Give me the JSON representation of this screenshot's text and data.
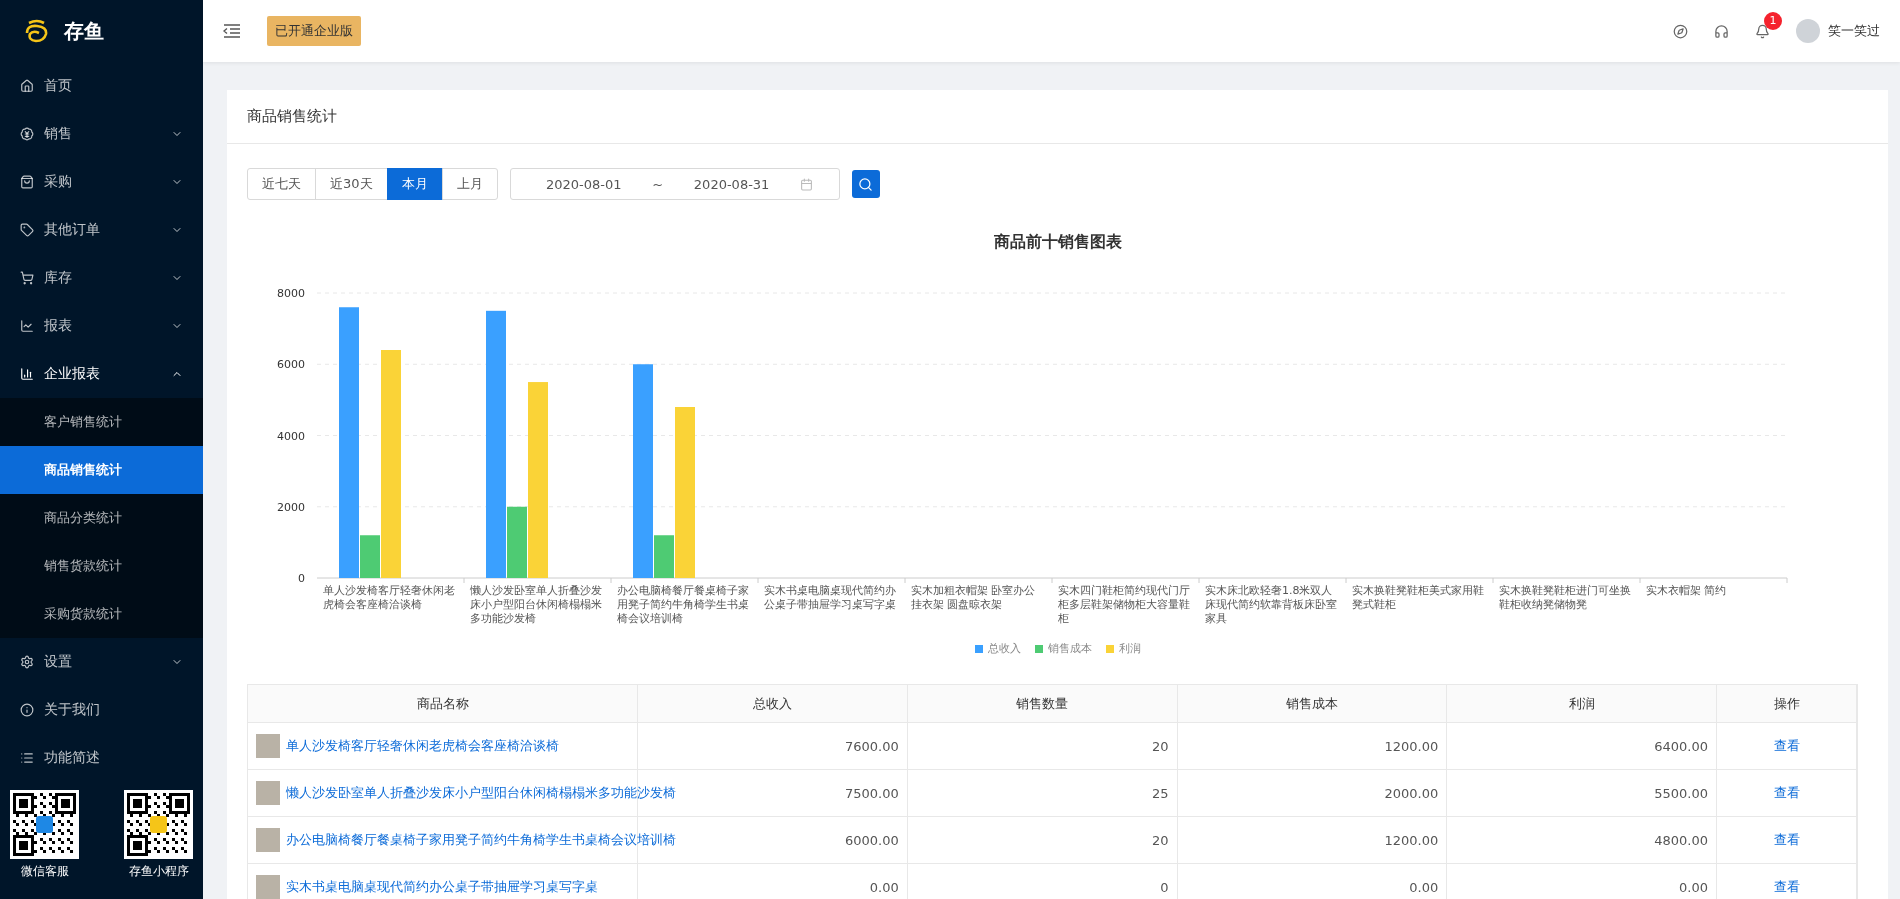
{
  "sidebar": {
    "logo": "存鱼",
    "items": [
      {
        "label": "首页",
        "kind": "link"
      },
      {
        "label": "销售",
        "kind": "group",
        "expanded": false
      },
      {
        "label": "采购",
        "kind": "group",
        "expanded": false
      },
      {
        "label": "其他订单",
        "kind": "group",
        "expanded": false
      },
      {
        "label": "库存",
        "kind": "group",
        "expanded": false
      },
      {
        "label": "报表",
        "kind": "group",
        "expanded": false
      },
      {
        "label": "企业报表",
        "kind": "group",
        "expanded": true,
        "children": [
          {
            "label": "客户销售统计",
            "selected": false
          },
          {
            "label": "商品销售统计",
            "selected": true
          },
          {
            "label": "商品分类统计",
            "selected": false
          },
          {
            "label": "销售货款统计",
            "selected": false
          },
          {
            "label": "采购货款统计",
            "selected": false
          }
        ]
      },
      {
        "label": "设置",
        "kind": "group",
        "expanded": false
      },
      {
        "label": "关于我们",
        "kind": "link"
      },
      {
        "label": "功能简述",
        "kind": "link"
      }
    ],
    "qr_codes": [
      {
        "caption": "微信客服"
      },
      {
        "caption": "存鱼小程序"
      }
    ]
  },
  "topbar": {
    "badge": "已开通企业版",
    "notification_count": "1",
    "user": "笑一笑过"
  },
  "page": {
    "title": "商品销售统计",
    "ranges": [
      {
        "label": "近七天",
        "selected": false
      },
      {
        "label": "近30天",
        "selected": false
      },
      {
        "label": "本月",
        "selected": true
      },
      {
        "label": "上月",
        "selected": false
      }
    ],
    "date_start": "2020-08-01",
    "date_separator": "~",
    "date_end": "2020-08-31"
  },
  "chart_data": {
    "type": "bar",
    "title": "商品前十销售图表",
    "categories": [
      "单人沙发椅客厅轻奢休闲老虎椅会客座椅洽谈椅",
      "懒人沙发卧室单人折叠沙发床小户型阳台休闲椅榻榻米多功能沙发椅",
      "办公电脑椅餐厅餐桌椅子家用凳子简约牛角椅学生书桌椅会议培训椅",
      "实木书桌电脑桌现代简约办公桌子带抽屉学习桌写字桌",
      "实木加粗衣帽架 卧室办公挂衣架 圆盘晾衣架",
      "实木四门鞋柜简约现代门厅柜多层鞋架储物柜大容量鞋柜",
      "实木床北欧轻奢1.8米双人床现代简约软靠背板床卧室家具",
      "实木换鞋凳鞋柜美式家用鞋凳式鞋柜",
      "实木换鞋凳鞋柜进门可坐换鞋柜收纳凳储物凳",
      "实木衣帽架 简约"
    ],
    "series": [
      {
        "name": "总收入",
        "color": "#3aa0ff",
        "values": [
          7600,
          7500,
          6000,
          0,
          0,
          0,
          0,
          0,
          0,
          0
        ]
      },
      {
        "name": "销售成本",
        "color": "#4ecb73",
        "values": [
          1200,
          2000,
          1200,
          0,
          0,
          0,
          0,
          0,
          0,
          0
        ]
      },
      {
        "name": "利润",
        "color": "#fad337",
        "values": [
          6400,
          5500,
          4800,
          0,
          0,
          0,
          0,
          0,
          0,
          0
        ]
      }
    ],
    "ylim": [
      0,
      8000
    ],
    "yticks": [
      0,
      2000,
      4000,
      6000,
      8000
    ],
    "grid": true,
    "legend": true
  },
  "table": {
    "columns": [
      "商品名称",
      "总收入",
      "销售数量",
      "销售成本",
      "利润",
      "操作"
    ],
    "rows": [
      {
        "name": "单人沙发椅客厅轻奢休闲老虎椅会客座椅洽谈椅",
        "cells": [
          "7600.00",
          "20",
          "1200.00",
          "6400.00"
        ],
        "action": "查看"
      },
      {
        "name": "懒人沙发卧室单人折叠沙发床小户型阳台休闲椅榻榻米多功能沙发椅",
        "cells": [
          "7500.00",
          "25",
          "2000.00",
          "5500.00"
        ],
        "action": "查看"
      },
      {
        "name": "办公电脑椅餐厅餐桌椅子家用凳子简约牛角椅学生书桌椅会议培训椅",
        "cells": [
          "6000.00",
          "20",
          "1200.00",
          "4800.00"
        ],
        "action": "查看"
      },
      {
        "name": "实木书桌电脑桌现代简约办公桌子带抽屉学习桌写字桌",
        "cells": [
          "0.00",
          "0",
          "0.00",
          "0.00"
        ],
        "action": "查看"
      }
    ]
  }
}
